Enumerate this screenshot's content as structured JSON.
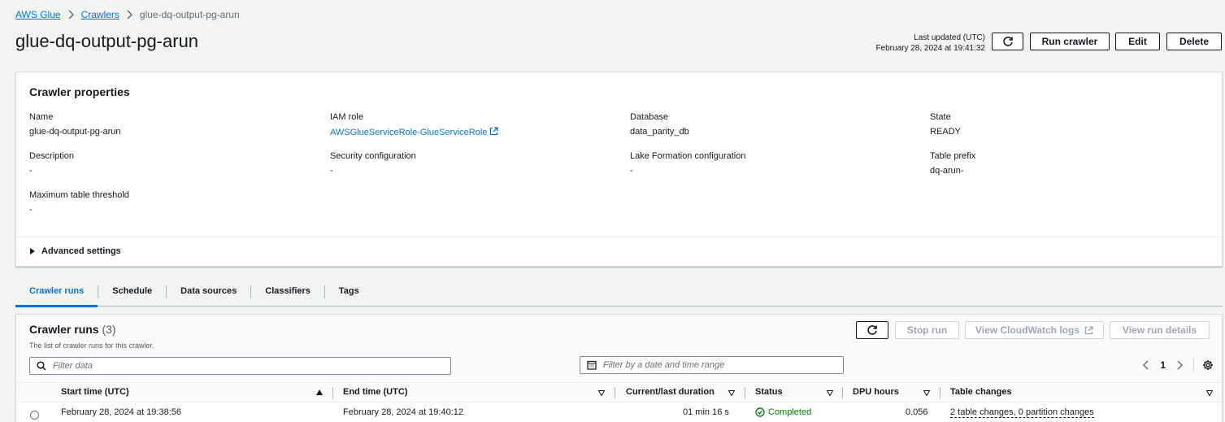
{
  "breadcrumb": {
    "root": "AWS Glue",
    "crawlers": "Crawlers",
    "current": "glue-dq-output-pg-arun"
  },
  "page": {
    "title": "glue-dq-output-pg-arun",
    "last_updated_label": "Last updated (UTC)",
    "last_updated_value": "February 28, 2024 at 19:41:32"
  },
  "actions": {
    "run_crawler": "Run crawler",
    "edit": "Edit",
    "delete": "Delete"
  },
  "properties": {
    "header": "Crawler properties",
    "name_label": "Name",
    "name_value": "glue-dq-output-pg-arun",
    "iam_label": "IAM role",
    "iam_value": "AWSGlueServiceRole-GlueServiceRole",
    "database_label": "Database",
    "database_value": "data_parity_db",
    "state_label": "State",
    "state_value": "READY",
    "description_label": "Description",
    "description_value": "-",
    "security_label": "Security configuration",
    "security_value": "-",
    "lake_label": "Lake Formation configuration",
    "lake_value": "-",
    "prefix_label": "Table prefix",
    "prefix_value": "dq-arun-",
    "max_label": "Maximum table threshold",
    "max_value": "-",
    "advanced": "Advanced settings"
  },
  "tabs": [
    "Crawler runs",
    "Schedule",
    "Data sources",
    "Classifiers",
    "Tags"
  ],
  "runs": {
    "title": "Crawler runs",
    "count": "(3)",
    "description": "The list of crawler runs for this crawler.",
    "stop_run": "Stop run",
    "view_logs": "View CloudWatch logs",
    "view_details": "View run details",
    "filter_placeholder": "Filter data",
    "date_placeholder": "Filter by a date and time range",
    "page": "1",
    "columns": {
      "start": "Start time (UTC)",
      "end": "End time (UTC)",
      "duration": "Current/last duration",
      "status": "Status",
      "dpu": "DPU hours",
      "changes": "Table changes"
    },
    "rows": [
      {
        "start": "February 28, 2024 at 19:38:56",
        "end": "February 28, 2024 at 19:40:12",
        "duration": "01 min 16 s",
        "status": "Completed",
        "dpu": "0.056",
        "changes": "2 table changes, 0 partition changes"
      }
    ]
  },
  "colors": {
    "link": "#0972d3",
    "success": "#037f0c",
    "text": "#16191f"
  }
}
